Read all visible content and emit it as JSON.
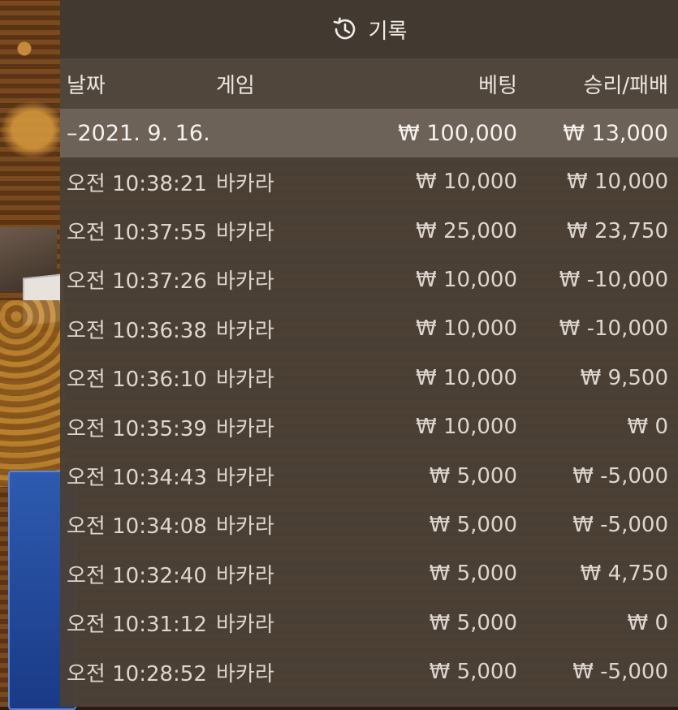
{
  "header": {
    "title": "기록",
    "icon": "history-icon"
  },
  "columns": {
    "date": "날짜",
    "game": "게임",
    "bet": "베팅",
    "winloss": "승리/패배"
  },
  "summary": {
    "date": "–2021. 9. 16.",
    "bet": "₩ 100,000",
    "winloss": "₩ 13,000"
  },
  "rows": [
    {
      "time": "오전 10:38:21",
      "game": "바카라",
      "bet": "₩ 10,000",
      "winloss": "₩ 10,000"
    },
    {
      "time": "오전 10:37:55",
      "game": "바카라",
      "bet": "₩ 25,000",
      "winloss": "₩ 23,750"
    },
    {
      "time": "오전 10:37:26",
      "game": "바카라",
      "bet": "₩ 10,000",
      "winloss": "₩ -10,000"
    },
    {
      "time": "오전 10:36:38",
      "game": "바카라",
      "bet": "₩ 10,000",
      "winloss": "₩ -10,000"
    },
    {
      "time": "오전 10:36:10",
      "game": "바카라",
      "bet": "₩ 10,000",
      "winloss": "₩ 9,500"
    },
    {
      "time": "오전 10:35:39",
      "game": "바카라",
      "bet": "₩ 10,000",
      "winloss": "₩ 0"
    },
    {
      "time": "오전 10:34:43",
      "game": "바카라",
      "bet": "₩ 5,000",
      "winloss": "₩ -5,000"
    },
    {
      "time": "오전 10:34:08",
      "game": "바카라",
      "bet": "₩ 5,000",
      "winloss": "₩ -5,000"
    },
    {
      "time": "오전 10:32:40",
      "game": "바카라",
      "bet": "₩ 5,000",
      "winloss": "₩ 4,750"
    },
    {
      "time": "오전 10:31:12",
      "game": "바카라",
      "bet": "₩ 5,000",
      "winloss": "₩ 0"
    },
    {
      "time": "오전 10:28:52",
      "game": "바카라",
      "bet": "₩ 5,000",
      "winloss": "₩ -5,000"
    }
  ]
}
